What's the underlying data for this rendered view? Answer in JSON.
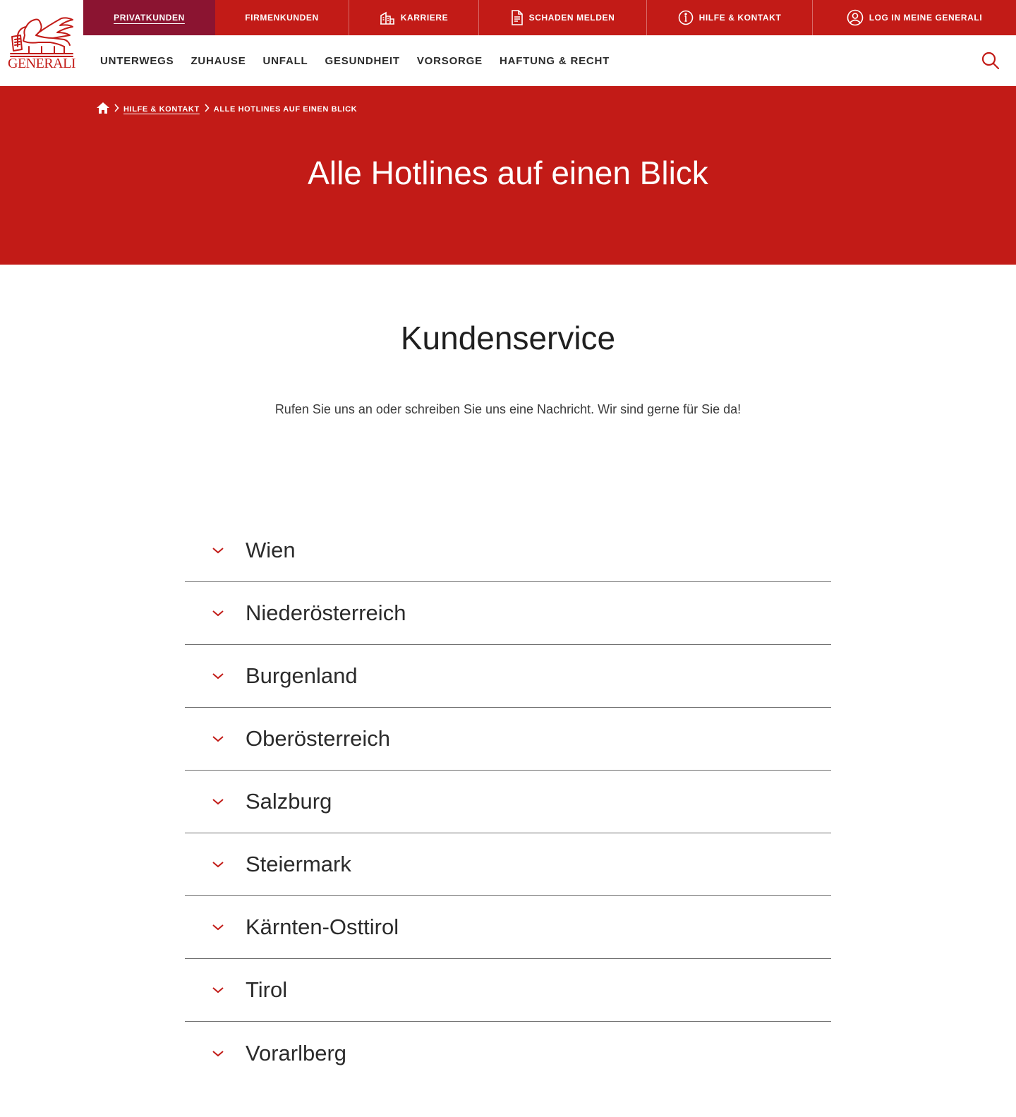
{
  "brand": {
    "name": "GENERALI",
    "accent": "#c21b17",
    "active_tab_color": "#8b1431"
  },
  "topbar": [
    {
      "label": "PRIVATKUNDEN",
      "icon": "",
      "active": true
    },
    {
      "label": "FIRMENKUNDEN",
      "icon": ""
    },
    {
      "label": "KARRIERE",
      "icon": "building-icon"
    },
    {
      "label": "SCHADEN MELDEN",
      "icon": "document-icon"
    },
    {
      "label": "HILFE & KONTAKT",
      "icon": "info-icon"
    },
    {
      "label": "LOG IN MEINE GENERALI",
      "icon": "user-icon"
    }
  ],
  "mainnav": [
    {
      "label": "UNTERWEGS"
    },
    {
      "label": "ZUHAUSE"
    },
    {
      "label": "UNFALL"
    },
    {
      "label": "GESUNDHEIT"
    },
    {
      "label": "VORSORGE"
    },
    {
      "label": "HAFTUNG & RECHT"
    }
  ],
  "search": {
    "icon": "search-icon"
  },
  "breadcrumb": {
    "home_icon": "home-icon",
    "items": [
      "HILFE & KONTAKT",
      "ALLE HOTLINES AUF EINEN BLICK"
    ]
  },
  "hero": {
    "title": "Alle Hotlines auf einen Blick"
  },
  "section": {
    "title": "Kundenservice",
    "intro": "Rufen Sie uns an oder schreiben Sie uns eine Nachricht. Wir sind gerne für Sie da!"
  },
  "regions": [
    {
      "label": "Wien"
    },
    {
      "label": "Niederösterreich"
    },
    {
      "label": "Burgenland"
    },
    {
      "label": "Oberösterreich"
    },
    {
      "label": "Salzburg"
    },
    {
      "label": "Steiermark"
    },
    {
      "label": "Kärnten-Osttirol"
    },
    {
      "label": "Tirol"
    },
    {
      "label": "Vorarlberg"
    }
  ]
}
